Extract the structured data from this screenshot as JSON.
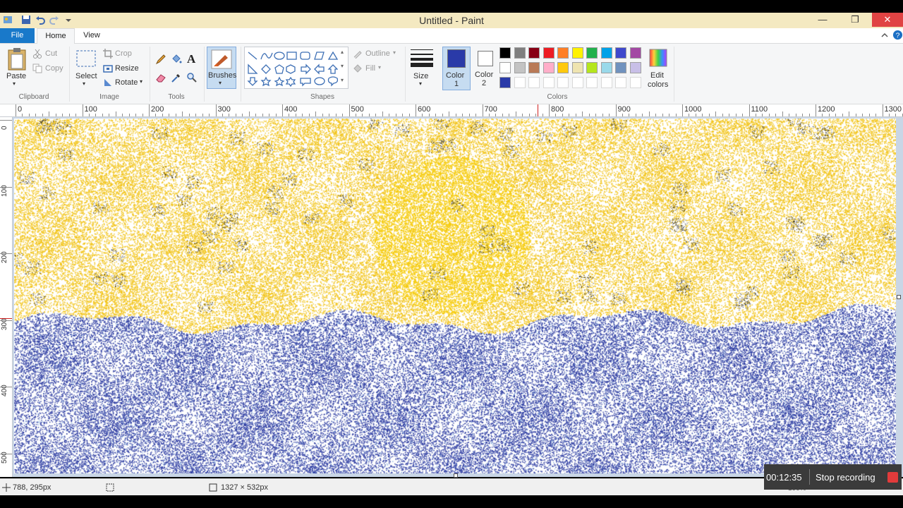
{
  "window": {
    "title": "Untitled - Paint",
    "buttons": {
      "minimize": "—",
      "restore": "❐",
      "close": "✕"
    }
  },
  "tabs": {
    "file": "File",
    "home": "Home",
    "view": "View"
  },
  "ribbon": {
    "clipboard": {
      "group": "Clipboard",
      "paste": "Paste",
      "cut": "Cut",
      "copy": "Copy"
    },
    "image": {
      "group": "Image",
      "select": "Select",
      "crop": "Crop",
      "resize": "Resize",
      "rotate": "Rotate"
    },
    "tools": {
      "group": "Tools",
      "text_glyph": "A"
    },
    "brushes": {
      "label": "Brushes"
    },
    "shapes": {
      "group": "Shapes",
      "outline": "Outline",
      "fill": "Fill"
    },
    "size": {
      "label": "Size"
    },
    "color1": {
      "label": "Color",
      "num": "1"
    },
    "color2": {
      "label": "Color",
      "num": "2"
    },
    "colors": {
      "group": "Colors",
      "edit_line1": "Edit",
      "edit_line2": "colors"
    }
  },
  "palette": {
    "row1": [
      "#000000",
      "#7f7f7f",
      "#880015",
      "#ed1c24",
      "#ff7f27",
      "#fff200",
      "#22b14c",
      "#00a2e8",
      "#3f48cc",
      "#a349a4"
    ],
    "row2": [
      "#ffffff",
      "#c3c3c3",
      "#b97a57",
      "#ffaec9",
      "#ffc90e",
      "#efe4b0",
      "#b5e61d",
      "#99d9ea",
      "#7092be",
      "#c8bfe7"
    ],
    "row3": [
      "#2a3aa8",
      "#ffffff",
      "#ffffff",
      "#ffffff",
      "#ffffff",
      "#ffffff",
      "#ffffff",
      "#ffffff",
      "#ffffff",
      "#ffffff"
    ],
    "color1": "#2a3aa8",
    "color2": "#ffffff"
  },
  "ruler": {
    "h": [
      "0",
      "100",
      "200",
      "300",
      "400",
      "500",
      "600",
      "700",
      "800",
      "900",
      "1000",
      "1100",
      "1200",
      "1300"
    ],
    "v": [
      "0",
      "100",
      "200",
      "300",
      "400",
      "500"
    ]
  },
  "painting": {
    "sky": "#f2c418",
    "sun": "#f6cc10",
    "sea": "#2f3ea3",
    "speckle": "#222222",
    "highlight": "#8ab0e0"
  },
  "status": {
    "cursor_pos": "788, 295px",
    "image_size": "1327 × 532px",
    "zoom": "100%"
  },
  "recorder": {
    "time": "00:12:35",
    "label": "Stop recording"
  }
}
